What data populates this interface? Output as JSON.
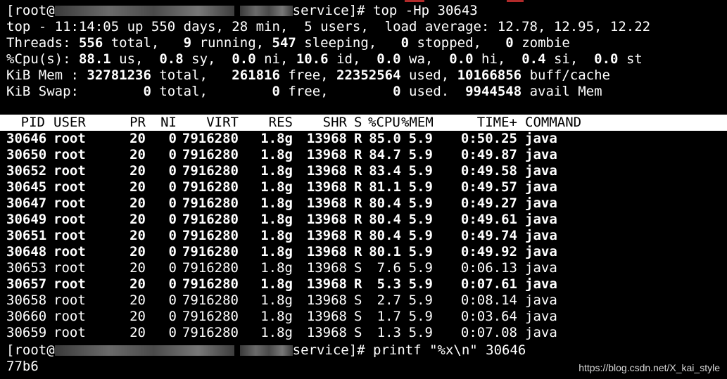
{
  "prompt1": {
    "prefix": "[root@",
    "suffix": "service]# top -Hp 30643"
  },
  "top_line": "top - 11:14:05 up 550 days, 28 min,  5 users,  load average: 12.78, 12.95, 12.22",
  "threads": {
    "label": "Threads: ",
    "total": "556",
    "t1": " total,   ",
    "running": "9",
    "t2": " running, ",
    "sleeping": "547",
    "t3": " sleeping,   ",
    "stopped": "0",
    "t4": " stopped,   ",
    "zombie": "0",
    "t5": " zombie"
  },
  "cpu": {
    "label": "%Cpu(s): ",
    "us": "88.1",
    "t1": " us,  ",
    "sy": "0.8",
    "t2": " sy,  ",
    "ni": "0.0",
    "t3": " ni, ",
    "id": "10.6",
    "t4": " id,  ",
    "wa": "0.0",
    "t5": " wa,  ",
    "hi": "0.0",
    "t6": " hi,  ",
    "si": "0.4",
    "t7": " si,  ",
    "st": "0.0",
    "t8": " st"
  },
  "mem": {
    "label": "KiB Mem : ",
    "total": "32781236",
    "t1": " total,   ",
    "free": "261816",
    "t2": " free, ",
    "used": "22352564",
    "t3": " used, ",
    "cache": "10166856",
    "t4": " buff/cache"
  },
  "swap": {
    "label": "KiB Swap:        ",
    "total": "0",
    "t1": " total,        ",
    "free": "0",
    "t2": " free,        ",
    "used": "0",
    "t3": " used.  ",
    "avail": "9944548",
    "t4": " avail Mem"
  },
  "header": {
    "pid": "PID",
    "user": "USER",
    "pr": "PR",
    "ni": "NI",
    "virt": "VIRT",
    "res": "RES",
    "shr": "SHR",
    "s": "S",
    "cpu": "%CPU",
    "mem": "%MEM",
    "time": "TIME+",
    "cmd": "COMMAND"
  },
  "rows": [
    {
      "pid": "30646",
      "user": "root",
      "pr": "20",
      "ni": "0",
      "virt": "7916280",
      "res": "1.8g",
      "shr": "13968",
      "s": "R",
      "cpu": "85.0",
      "mem": "5.9",
      "time": "0:50.25",
      "cmd": "java",
      "bold": true
    },
    {
      "pid": "30650",
      "user": "root",
      "pr": "20",
      "ni": "0",
      "virt": "7916280",
      "res": "1.8g",
      "shr": "13968",
      "s": "R",
      "cpu": "84.7",
      "mem": "5.9",
      "time": "0:49.87",
      "cmd": "java",
      "bold": true
    },
    {
      "pid": "30652",
      "user": "root",
      "pr": "20",
      "ni": "0",
      "virt": "7916280",
      "res": "1.8g",
      "shr": "13968",
      "s": "R",
      "cpu": "83.4",
      "mem": "5.9",
      "time": "0:49.58",
      "cmd": "java",
      "bold": true
    },
    {
      "pid": "30645",
      "user": "root",
      "pr": "20",
      "ni": "0",
      "virt": "7916280",
      "res": "1.8g",
      "shr": "13968",
      "s": "R",
      "cpu": "81.1",
      "mem": "5.9",
      "time": "0:49.57",
      "cmd": "java",
      "bold": true
    },
    {
      "pid": "30647",
      "user": "root",
      "pr": "20",
      "ni": "0",
      "virt": "7916280",
      "res": "1.8g",
      "shr": "13968",
      "s": "R",
      "cpu": "80.4",
      "mem": "5.9",
      "time": "0:49.27",
      "cmd": "java",
      "bold": true
    },
    {
      "pid": "30649",
      "user": "root",
      "pr": "20",
      "ni": "0",
      "virt": "7916280",
      "res": "1.8g",
      "shr": "13968",
      "s": "R",
      "cpu": "80.4",
      "mem": "5.9",
      "time": "0:49.61",
      "cmd": "java",
      "bold": true
    },
    {
      "pid": "30651",
      "user": "root",
      "pr": "20",
      "ni": "0",
      "virt": "7916280",
      "res": "1.8g",
      "shr": "13968",
      "s": "R",
      "cpu": "80.4",
      "mem": "5.9",
      "time": "0:49.74",
      "cmd": "java",
      "bold": true
    },
    {
      "pid": "30648",
      "user": "root",
      "pr": "20",
      "ni": "0",
      "virt": "7916280",
      "res": "1.8g",
      "shr": "13968",
      "s": "R",
      "cpu": "80.1",
      "mem": "5.9",
      "time": "0:49.92",
      "cmd": "java",
      "bold": true
    },
    {
      "pid": "30653",
      "user": "root",
      "pr": "20",
      "ni": "0",
      "virt": "7916280",
      "res": "1.8g",
      "shr": "13968",
      "s": "S",
      "cpu": "7.6",
      "mem": "5.9",
      "time": "0:06.13",
      "cmd": "java",
      "bold": false
    },
    {
      "pid": "30657",
      "user": "root",
      "pr": "20",
      "ni": "0",
      "virt": "7916280",
      "res": "1.8g",
      "shr": "13968",
      "s": "R",
      "cpu": "5.3",
      "mem": "5.9",
      "time": "0:07.61",
      "cmd": "java",
      "bold": true
    },
    {
      "pid": "30658",
      "user": "root",
      "pr": "20",
      "ni": "0",
      "virt": "7916280",
      "res": "1.8g",
      "shr": "13968",
      "s": "S",
      "cpu": "2.7",
      "mem": "5.9",
      "time": "0:08.14",
      "cmd": "java",
      "bold": false
    },
    {
      "pid": "30660",
      "user": "root",
      "pr": "20",
      "ni": "0",
      "virt": "7916280",
      "res": "1.8g",
      "shr": "13968",
      "s": "S",
      "cpu": "1.7",
      "mem": "5.9",
      "time": "0:03.64",
      "cmd": "java",
      "bold": false
    },
    {
      "pid": "30659",
      "user": "root",
      "pr": "20",
      "ni": "0",
      "virt": "7916280",
      "res": "1.8g",
      "shr": "13968",
      "s": "S",
      "cpu": "1.3",
      "mem": "5.9",
      "time": "0:07.08",
      "cmd": "java",
      "bold": false
    }
  ],
  "prompt2": {
    "prefix": "[root@",
    "suffix": "service]# printf \"%x\\n\" 30646"
  },
  "hex_output": "77b6",
  "watermark": "https://blog.csdn.net/X_kai_style",
  "colors": {
    "background": "#000000",
    "text": "#ffffff",
    "header_bg": "#ffffff",
    "header_text": "#000000"
  }
}
